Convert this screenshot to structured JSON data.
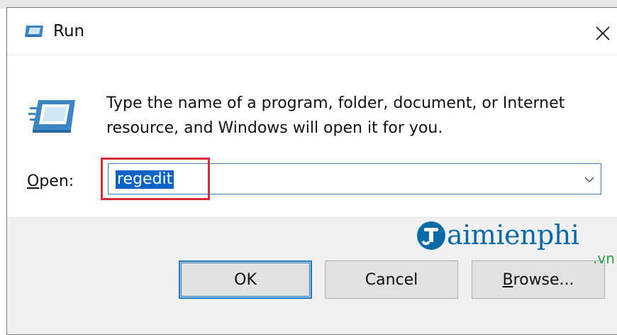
{
  "window": {
    "title": "Run"
  },
  "content": {
    "description_line1": "Type the name of a program, folder, document, or Internet",
    "description_line2": "resource, and Windows will open it for you.",
    "open_label_mnemonic": "O",
    "open_label_rest": "pen:",
    "open_value": "regedit"
  },
  "buttons": {
    "ok": "OK",
    "cancel": "Cancel",
    "browse_mnemonic": "B",
    "browse_rest": "rowse..."
  },
  "watermark": {
    "text": "aimienphi",
    "suffix": ".vn"
  },
  "icons": {
    "title": "run-icon",
    "main": "run-icon",
    "close": "close-icon",
    "dropdown": "chevron-down-icon"
  },
  "colors": {
    "selection": "#0a64c8",
    "focus_border": "#1b78c8",
    "highlight": "#d52b3a",
    "footer_bg": "#f0f0f0",
    "watermark_blue": "#0a6aa8",
    "watermark_green": "#2aa14b"
  }
}
